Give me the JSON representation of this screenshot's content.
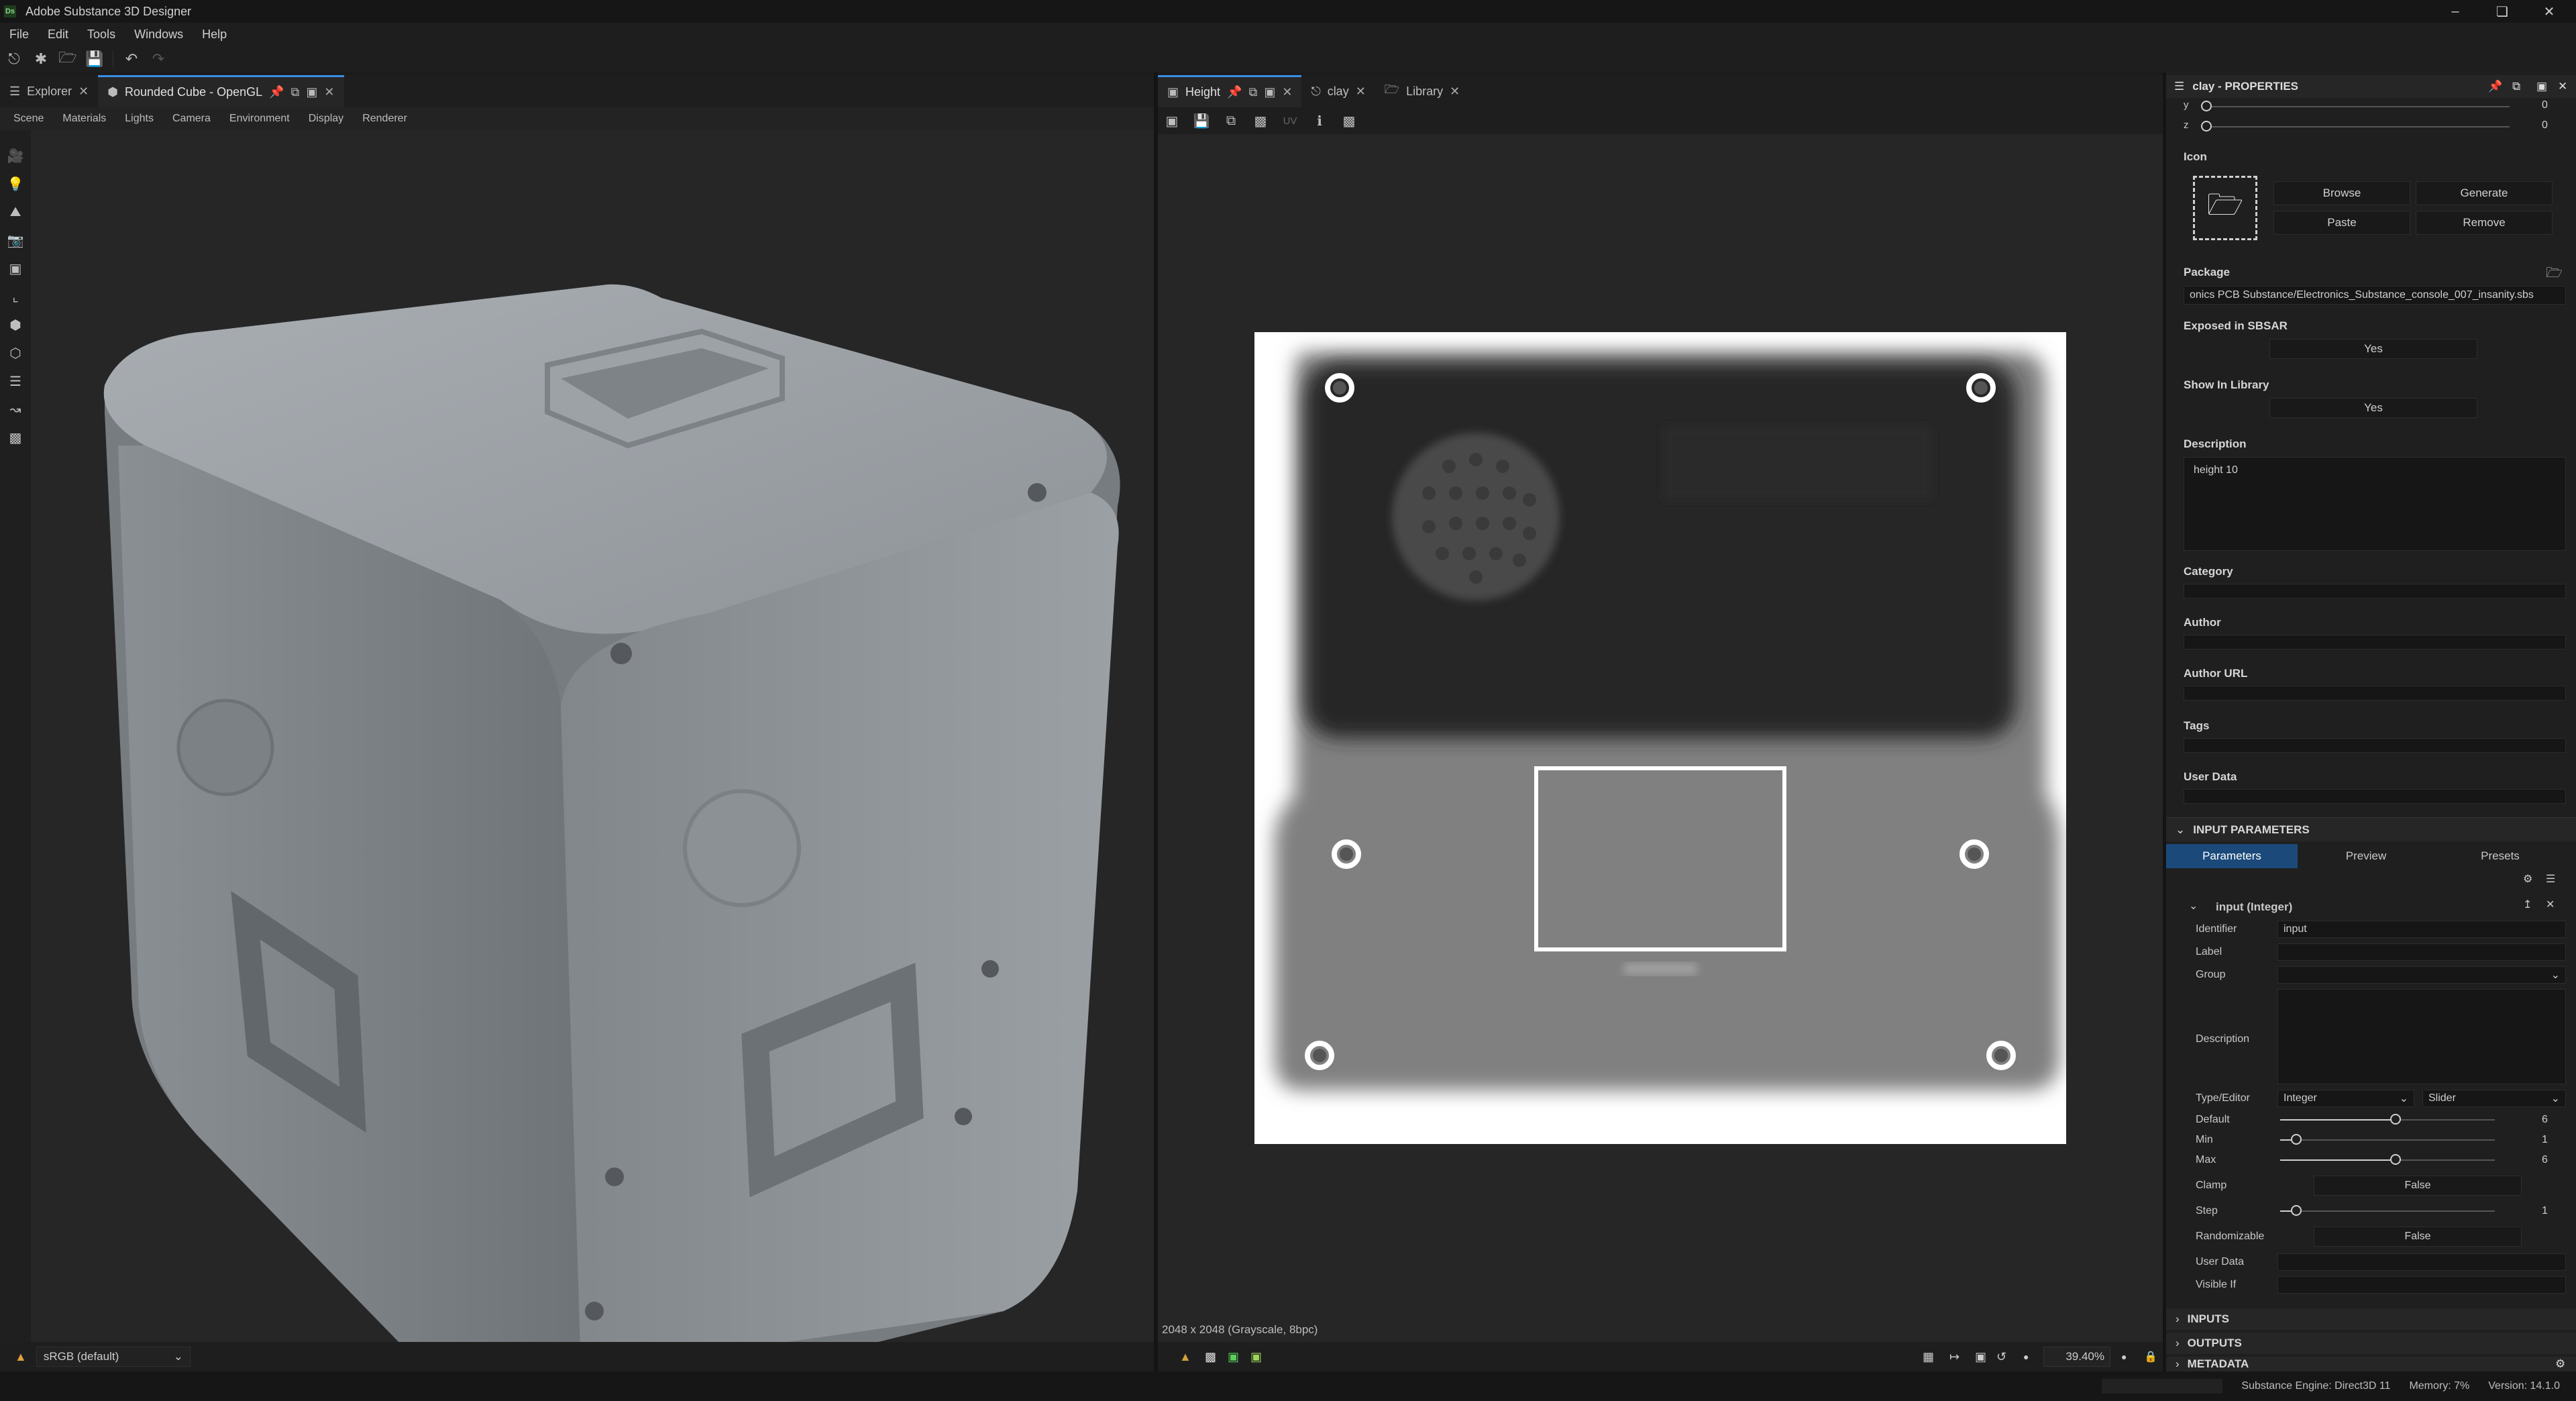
{
  "app": {
    "title": "Adobe Substance 3D Designer",
    "logo_text": "Ds"
  },
  "menu": [
    "File",
    "Edit",
    "Tools",
    "Windows",
    "Help"
  ],
  "left_panel": {
    "tabs": [
      {
        "label": "Explorer"
      },
      {
        "label": "Rounded Cube - OpenGL"
      }
    ],
    "viewport_menu": [
      "Scene",
      "Materials",
      "Lights",
      "Camera",
      "Environment",
      "Display",
      "Renderer"
    ],
    "colorspace": "sRGB (default)"
  },
  "middle_panel": {
    "tabs": [
      {
        "label": "Height"
      },
      {
        "label": "clay"
      },
      {
        "label": "Library"
      }
    ],
    "uv_label": "UV",
    "image_info": "2048 x 2048 (Grayscale, 8bpc)",
    "zoom": "39.40%"
  },
  "properties": {
    "title": "clay - PROPERTIES",
    "y_value": "0",
    "z_value": "0",
    "icon_label": "Icon",
    "browse": "Browse",
    "generate": "Generate",
    "paste": "Paste",
    "remove": "Remove",
    "package_label": "Package",
    "package_value": "onics PCB Substance/Electronics_Substance_console_007_insanity.sbs",
    "exposed_label": "Exposed in SBSAR",
    "exposed_value": "Yes",
    "show_library_label": "Show In Library",
    "show_library_value": "Yes",
    "description_label": "Description",
    "description_value": "height 10",
    "category_label": "Category",
    "author_label": "Author",
    "author_url_label": "Author URL",
    "tags_label": "Tags",
    "user_data_label": "User Data",
    "input_params_label": "INPUT PARAMETERS",
    "subtabs": [
      "Parameters",
      "Preview",
      "Presets"
    ],
    "param": {
      "title": "input (Integer)",
      "identifier_label": "Identifier",
      "identifier_value": "input",
      "label_label": "Label",
      "group_label": "Group",
      "description_label": "Description",
      "type_editor_label": "Type/Editor",
      "type_value": "Integer",
      "editor_value": "Slider",
      "default_label": "Default",
      "default_value": "6",
      "min_label": "Min",
      "min_value": "1",
      "max_label": "Max",
      "max_value": "6",
      "clamp_label": "Clamp",
      "clamp_value": "False",
      "step_label": "Step",
      "step_value": "1",
      "randomizable_label": "Randomizable",
      "randomizable_value": "False",
      "user_data_label": "User Data",
      "visible_if_label": "Visible If"
    },
    "inputs_label": "INPUTS",
    "outputs_label": "OUTPUTS",
    "metadata_label": "METADATA"
  },
  "status": {
    "engine": "Substance Engine: Direct3D 11",
    "memory": "Memory: 7%",
    "version": "Version: 14.1.0"
  },
  "colors": {
    "accent": "#3a8ee6",
    "panel": "#1f1f1f",
    "viewport": "#262626"
  }
}
